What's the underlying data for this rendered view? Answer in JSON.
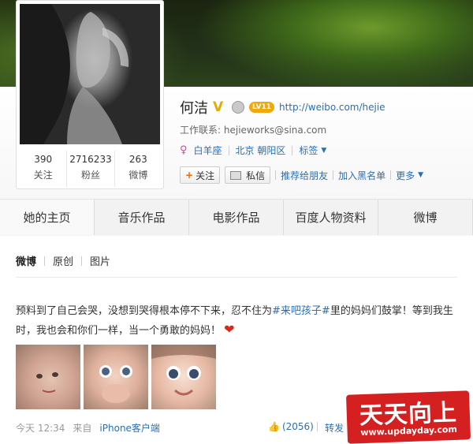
{
  "profile": {
    "name": "何洁",
    "badge": "V",
    "vip_label": "LV11",
    "url": "http://weibo.com/hejie",
    "contact_label": "工作联系:",
    "contact_email": "hejieworks@sina.com",
    "zodiac": "白羊座",
    "location": "北京 朝阳区",
    "tags_label": "标签",
    "stats": [
      {
        "num": "390",
        "label": "关注"
      },
      {
        "num": "2716233",
        "label": "粉丝"
      },
      {
        "num": "263",
        "label": "微博"
      }
    ]
  },
  "actions": {
    "follow": "关注",
    "message": "私信",
    "recommend": "推荐给朋友",
    "blacklist": "加入黑名单",
    "more": "更多"
  },
  "tabs": [
    "她的主页",
    "音乐作品",
    "电影作品",
    "百度人物资料",
    "微博"
  ],
  "subtabs": [
    "微博",
    "原创",
    "图片"
  ],
  "post": {
    "text_before": "预料到了自己会哭，没想到哭得根本停不下来，忍不住为",
    "hashtag": "#来吧孩子#",
    "text_after": "里的妈妈们鼓掌！等到我生时，我也会和你们一样，当一个勇敢的妈妈！",
    "time": "今天  12:34",
    "via_prefix": "来自",
    "via": "iPhone客户端",
    "likes": "(2056)",
    "repost": "转发"
  },
  "watermark": {
    "title": "天天向上",
    "url": "www.updayday.com"
  },
  "colors": {
    "link": "#2b6fb3",
    "watermark_bg": "#d21414",
    "vip": "#f0a90a"
  },
  "icons": [
    "v-verified-icon",
    "club-icon",
    "vip-icon",
    "female-icon",
    "plus-icon",
    "message-icon",
    "caret-down-icon",
    "heart-icon",
    "thumbs-up-icon"
  ]
}
